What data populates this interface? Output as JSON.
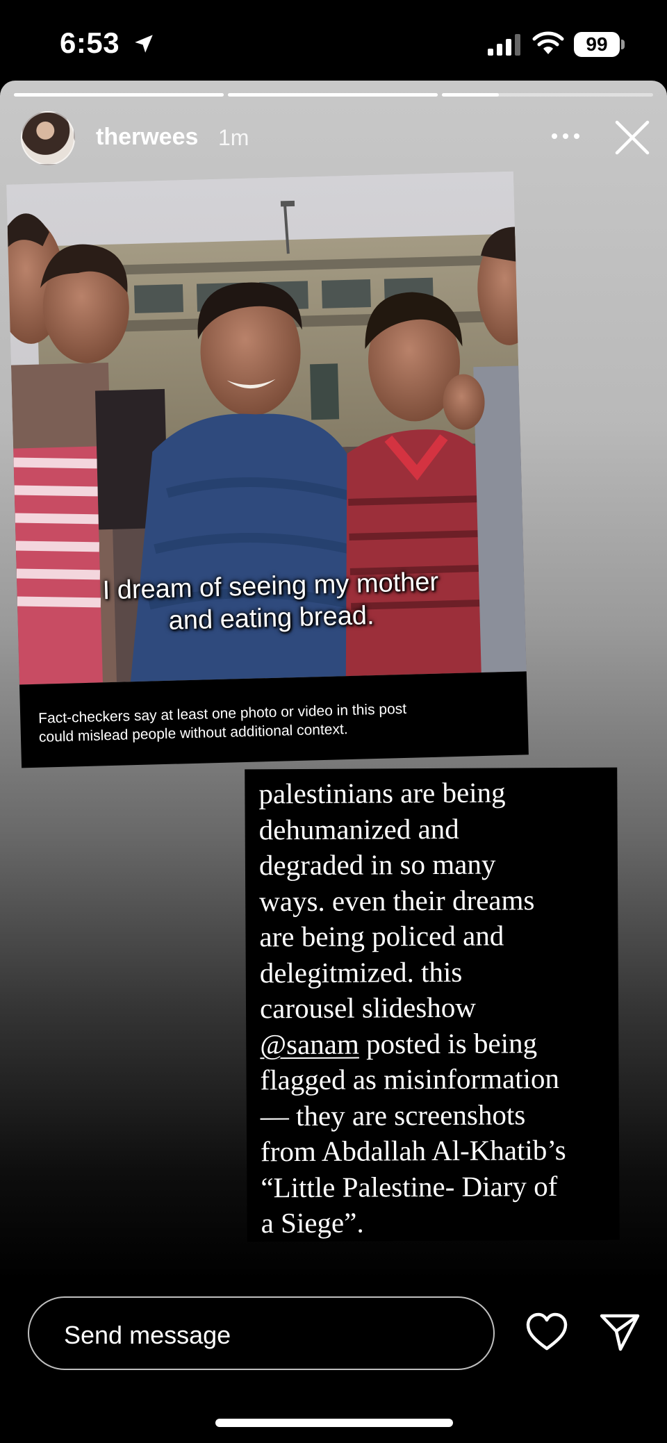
{
  "status_bar": {
    "time": "6:53",
    "battery": "99",
    "icons": [
      "location-arrow-icon",
      "cellular-signal-icon",
      "wifi-icon",
      "battery-icon"
    ]
  },
  "story": {
    "progress": [
      1.0,
      1.0,
      0.27
    ],
    "username": "therwees",
    "time_ago": "1m",
    "icons": [
      "more-icon",
      "close-icon"
    ],
    "post": {
      "caption_line1": "I dream of seeing my mother",
      "caption_line2": "and eating bread.",
      "factcheck_line1": "Fact-checkers say at least one photo or video in this post",
      "factcheck_line2": "could mislead people without additional context."
    },
    "text_lines": [
      "palestinians are being",
      "dehumanized and",
      "degraded in so many",
      "ways. even their dreams",
      "are being policed and",
      "delegitmized. this",
      "carousel slideshow",
      "posted is being",
      "flagged as misinformation",
      "— they are screenshots",
      "from Abdallah Al-Khatib’s",
      "“Little Palestine- Diary of",
      "a Siege”."
    ],
    "mention": "@sanam"
  },
  "footer": {
    "send_placeholder": "Send message",
    "icons": [
      "heart-icon",
      "share-icon"
    ]
  },
  "colors": {
    "background": "#000000",
    "text": "#ffffff",
    "story_gradient_top": "#c8c8c8"
  }
}
